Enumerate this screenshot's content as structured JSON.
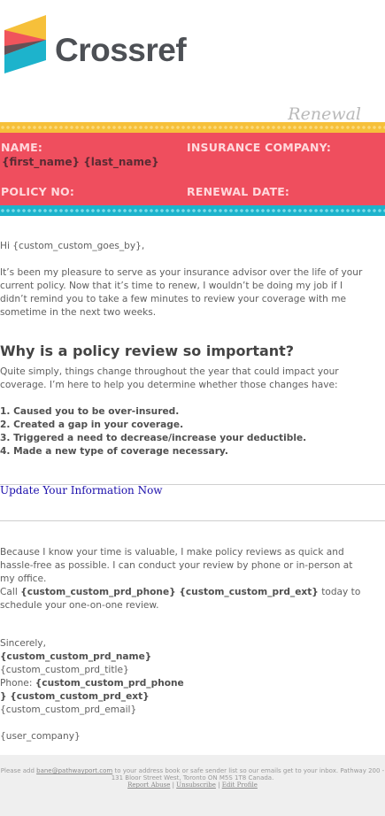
{
  "header": {
    "logo_text": "Crossref",
    "renewal_label": "Renewal"
  },
  "band": {
    "name_label": "NAME:",
    "name_value": "{first_name} {last_name}",
    "company_label": "INSURANCE COMPANY:",
    "policy_label": "POLICY NO:",
    "renewal_date_label": "RENEWAL DATE:"
  },
  "body": {
    "greeting": "Hi {custom_custom_goes_by},",
    "intro": "It’s been my pleasure to serve as your insurance advisor over the life of your current policy. Now that it’s time to renew, I wouldn’t be doing my job if I didn’t remind you to take a few minutes to review your coverage with me sometime in the next two weeks.",
    "heading": "Why is a policy review so important?",
    "lead": "Quite simply, things change throughout the year that could impact your coverage. I’m here to help you determine whether those changes have:",
    "reasons": [
      "1. Caused you to be over-insured.",
      "2. Created a gap in your coverage.",
      "3. Triggered a need to decrease/increase your deductible.",
      "4. Made a new type of coverage necessary."
    ],
    "update_link": "Update Your Information Now",
    "valuable": "Because I know your time is valuable, I make policy reviews as quick and hassle-free as possible. I can conduct your review by phone or in-person at my office.",
    "call_prefix": "Call ",
    "call_phone": "{custom_custom_prd_phone} {custom_custom_prd_ext}",
    "call_suffix": " today to schedule your one-on-one review."
  },
  "signature": {
    "closing": "Sincerely,",
    "name": "{custom_custom_prd_name}",
    "title": "{custom_custom_prd_title}",
    "phone_label": "Phone: ",
    "phone_value_line1": "{custom_custom_prd_phone",
    "phone_value_line2": "} {custom_custom_prd_ext}",
    "email": "{custom_custom_prd_email}",
    "company": "{user_company}"
  },
  "footer": {
    "text_prefix": "Please add ",
    "email_link": "bane@pathwayport.com",
    "text_suffix": " to your address book or safe sender list so our emails get to your inbox. Pathway 200 - 131 Bloor Street West, Toronto ON M5S 1T8 Canada.",
    "report_abuse": "Report Abuse",
    "unsubscribe": "Unsubscribe",
    "edit_profile": "Edit Profile",
    "separator": " | "
  },
  "colors": {
    "band_red": "#ef4e5e",
    "stripe_yellow": "#f6c03a",
    "stripe_blue": "#1db3cc",
    "logo_yellow": "#f6c03a",
    "logo_red": "#ef4e5e",
    "logo_teal": "#1db3cc",
    "logo_gray": "#4d5055"
  }
}
